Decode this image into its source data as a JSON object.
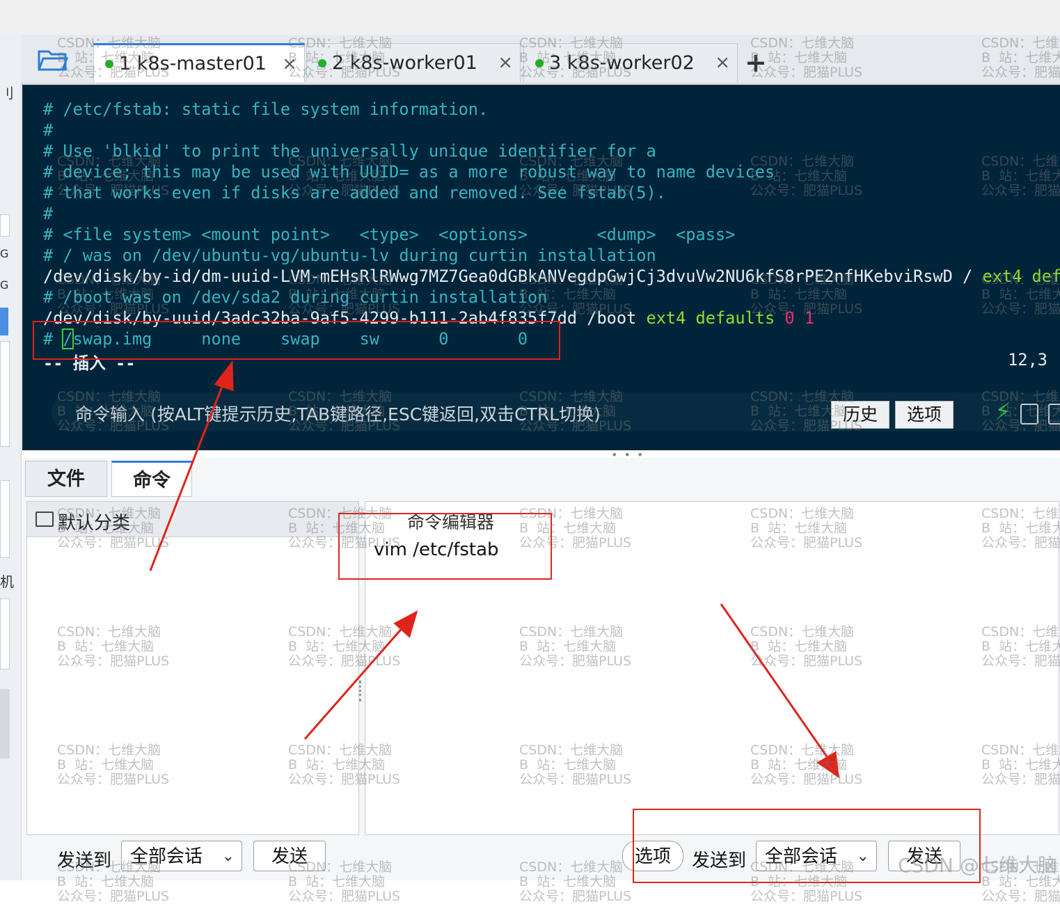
{
  "tabs": [
    {
      "label": "1 k8s-master01",
      "close": "×",
      "active": true
    },
    {
      "label": "2 k8s-worker01",
      "close": "×",
      "active": false
    },
    {
      "label": "3 k8s-worker02",
      "close": "×",
      "active": false
    }
  ],
  "new_tab": "+",
  "left_strip_chars": [
    "刂",
    "G",
    "G",
    "机"
  ],
  "terminal": {
    "lines": [
      "# /etc/fstab: static file system information.",
      "#",
      "# Use 'blkid' to print the universally unique identifier for a",
      "# device; this may be used with UUID= as a more robust way to name devices",
      "# that works even if disks are added and removed. See fstab(5).",
      "#",
      "# <file system> <mount point>   <type>  <options>       <dump>  <pass>",
      "# / was on /dev/ubuntu-vg/ubuntu-lv during curtin installation"
    ],
    "root_path": "/dev/disk/by-id/dm-uuid-LVM-mEHsRlRWwg7MZ7Gea0dGBkANVegdpGwjCj3dvuVw2NU6kfS8rPE2nfHKebviRswD / ",
    "root_type": "ext4",
    "root_opts": "defau",
    "boot_comment": "# /boot was on /dev/sda2 during curtin installation",
    "boot_path": "/dev/disk/by-uuid/3adc32ba-9af5-4299-b111-2ab4f835f7dd /boot ",
    "boot_type": "ext4",
    "boot_opts": "defaults",
    "boot_nums": "0 1",
    "swap_hash": "# ",
    "swap_cursor": "/",
    "swap_rest": "swap.img     none    swap    sw      0       0",
    "insert_mode": "-- 插入 --",
    "cursor_pos": "12,3"
  },
  "cmdbar": {
    "hint": "命令输入 (按ALT键提示历史,TAB键路径,ESC键返回,双击CTRL切换)",
    "history": "历史",
    "options": "选项"
  },
  "bottom_tabs": [
    "文件",
    "命令"
  ],
  "left_panel": {
    "category": "默认分类"
  },
  "editor": {
    "title": "命令编辑器",
    "content": "vim /etc/fstab"
  },
  "bottom_left": {
    "send_to": "发送到",
    "target": "全部会话",
    "send": "发送"
  },
  "bottom_right": {
    "options": "选项",
    "send_to": "发送到",
    "target": "全部会话",
    "send": "发送"
  },
  "watermark": "CSDN：七维大脑\nB  站：七维大脑\n公众号：肥猫PLUS",
  "credit": "CSDN @七维大脑",
  "colors": {
    "terminal_bg": "#00243a",
    "comment": "#33b4c2",
    "green": "#8ee02c",
    "magenta": "#e8336d",
    "annotation_red": "#e0241b"
  }
}
